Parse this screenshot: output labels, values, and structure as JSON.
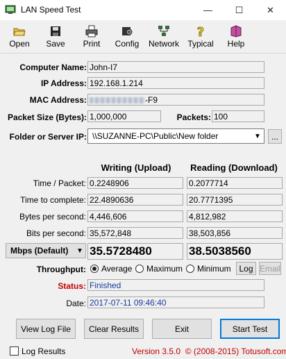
{
  "window": {
    "title": "LAN Speed Test",
    "minimize": "—",
    "maximize": "☐",
    "close": "✕"
  },
  "toolbar": {
    "items": [
      {
        "label": "Open"
      },
      {
        "label": "Save"
      },
      {
        "label": "Print"
      },
      {
        "label": "Config"
      },
      {
        "label": "Network"
      },
      {
        "label": "Typical"
      },
      {
        "label": "Help"
      }
    ]
  },
  "info": {
    "computer_name_label": "Computer Name:",
    "computer_name": "John-I7",
    "ip_label": "IP Address:",
    "ip": "192.168.1.214",
    "mac_label": "MAC Address:",
    "mac_suffix": "-F9",
    "packet_size_label": "Packet Size (Bytes):",
    "packet_size": "1,000,000",
    "packets_label": "Packets:",
    "packets": "100",
    "folder_label": "Folder or Server IP:",
    "folder_value": "\\\\SUZANNE-PC\\Public\\New folder",
    "browse_label": "..."
  },
  "results": {
    "writing_header": "Writing (Upload)",
    "reading_header": "Reading (Download)",
    "rows": [
      {
        "label": "Time / Packet:",
        "write": "0.2248906",
        "read": "0.2077714"
      },
      {
        "label": "Time to complete:",
        "write": "22.4890636",
        "read": "20.7771395"
      },
      {
        "label": "Bytes per second:",
        "write": "4,446,606",
        "read": "4,812,982"
      },
      {
        "label": "Bits per second:",
        "write": "35,572,848",
        "read": "38,503,856"
      }
    ],
    "unit_select": "Mbps (Default)",
    "write_mbps": "35.5728480",
    "read_mbps": "38.5038560"
  },
  "throughput": {
    "label": "Throughput:",
    "options": [
      "Average",
      "Maximum",
      "Minimum"
    ],
    "selected": "Average",
    "log_label": "Log",
    "email_label": "Email"
  },
  "status": {
    "label": "Status:",
    "value": "Finished",
    "date_label": "Date:",
    "date_value": "2017-07-11 09:46:40"
  },
  "actions": {
    "view_log": "View Log File",
    "clear": "Clear Results",
    "exit": "Exit",
    "start": "Start Test"
  },
  "footer": {
    "log_results": "Log Results",
    "version": "Version 3.5.0  © (2008-2015) Totusoft.com"
  },
  "colors": {
    "status_label": "#c00000",
    "field_blue": "#1a3a9c",
    "version_text": "#c00000",
    "default_button_border": "#0078d7"
  }
}
